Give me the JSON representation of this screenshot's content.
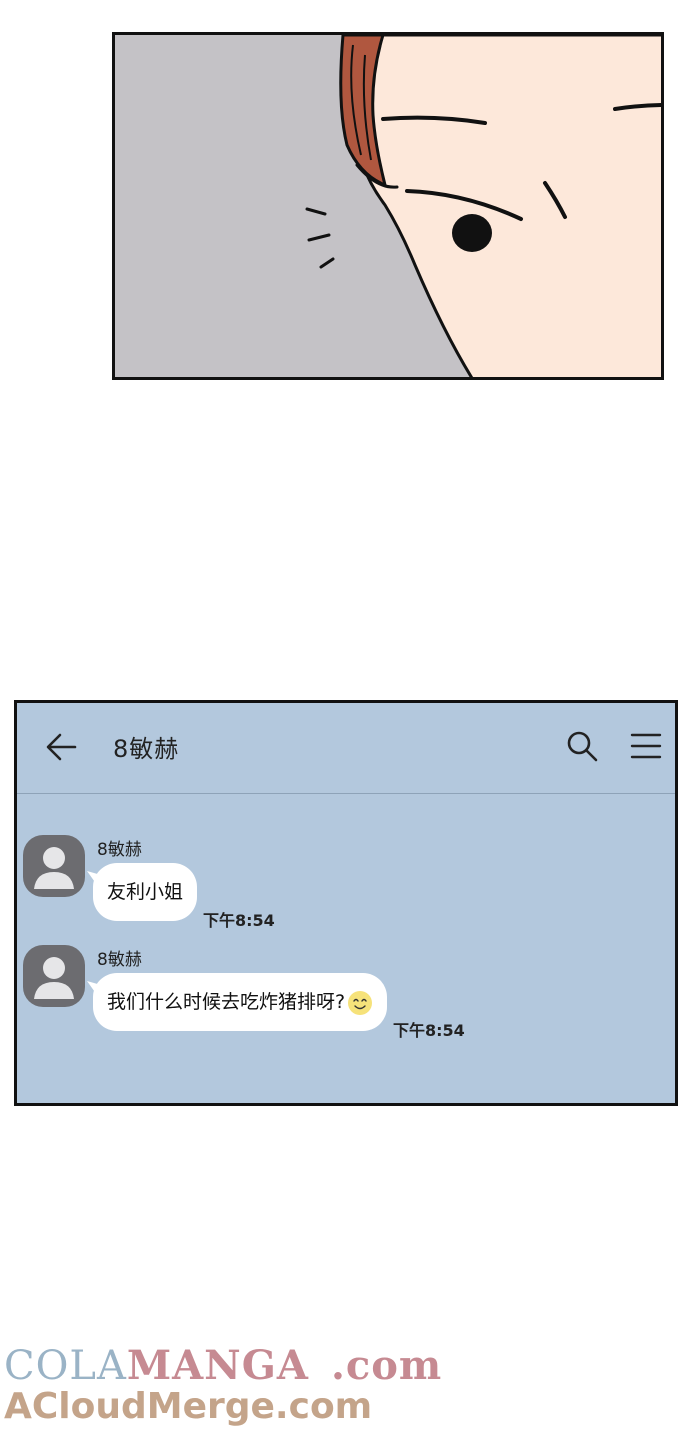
{
  "chat": {
    "title": "8敏赫",
    "messages": [
      {
        "sender": "8敏赫",
        "text": "友利小姐",
        "time": "下午8:54",
        "emoji": ""
      },
      {
        "sender": "8敏赫",
        "text": "我们什么时候去吃炸猪排呀?",
        "time": "下午8:54",
        "emoji": "smile-emoji"
      }
    ],
    "icons": {
      "back": "back-arrow-icon",
      "search": "search-icon",
      "menu": "menu-icon"
    },
    "colors": {
      "background": "#b3c8dd",
      "bubble": "#ffffff",
      "avatar": "#6c6c70"
    }
  },
  "watermark": {
    "part1": "COLA",
    "part2": "MANGA",
    "part3": ".com",
    "line2": "ACloudMerge.com"
  }
}
